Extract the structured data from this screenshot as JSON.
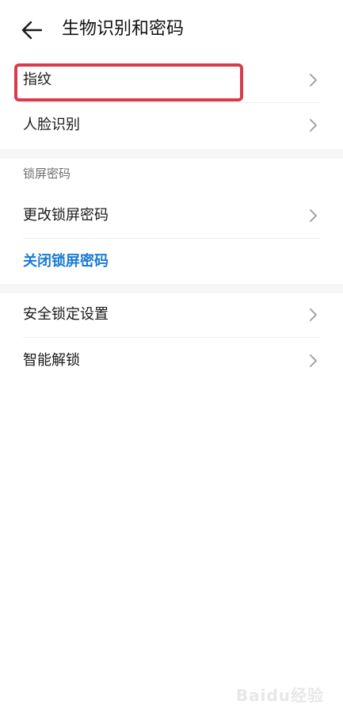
{
  "header": {
    "title": "生物识别和密码",
    "back_icon": "back-arrow-icon"
  },
  "biometrics": {
    "items": [
      {
        "label": "指纹",
        "icon": "chevron-right-icon",
        "highlighted": true
      },
      {
        "label": "人脸识别",
        "icon": "chevron-right-icon"
      }
    ]
  },
  "lock_screen": {
    "section_title": "锁屏密码",
    "change_label": "更改锁屏密码",
    "disable_label": "关闭锁屏密码"
  },
  "security": {
    "items": [
      {
        "label": "安全锁定设置",
        "icon": "chevron-right-icon"
      },
      {
        "label": "智能解锁",
        "icon": "chevron-right-icon"
      }
    ]
  },
  "colors": {
    "accent": "#1a7bd6",
    "highlight": "#d93a4c",
    "background": "#ffffff",
    "section_gap": "#f6f6f6"
  },
  "watermark": {
    "text": "Baidu经验"
  }
}
